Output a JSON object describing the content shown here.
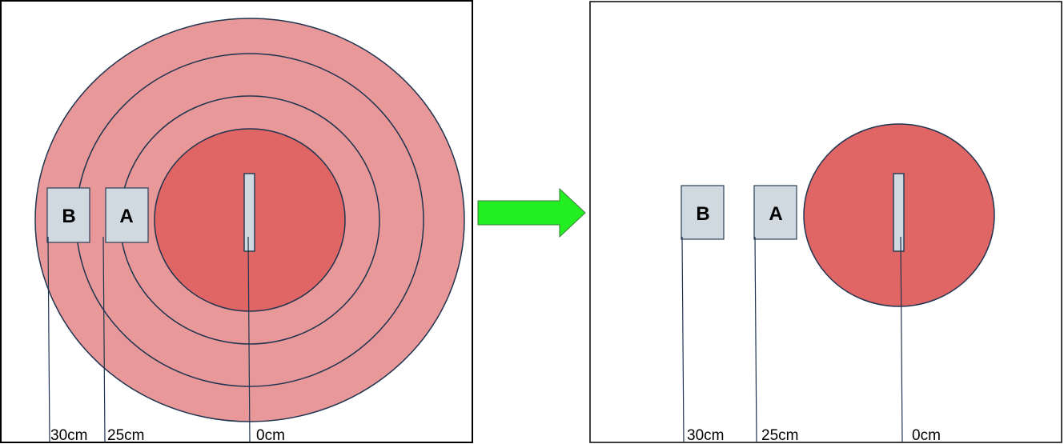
{
  "colors": {
    "outer_ring": "#e89898",
    "inner_zone": "#e06565",
    "ring_stroke": "#1f3450",
    "box_fill": "#d0d9e0",
    "box_stroke": "#2a3f55",
    "arrow_fill": "#22ee22",
    "arrow_stroke": "#3a7a3a",
    "text": "#000000"
  },
  "left_panel": {
    "boxes": [
      {
        "id": "B",
        "label": "B"
      },
      {
        "id": "A",
        "label": "A"
      }
    ],
    "distances": [
      "30cm",
      "25cm",
      "0cm"
    ]
  },
  "right_panel": {
    "boxes": [
      {
        "id": "B",
        "label": "B"
      },
      {
        "id": "A",
        "label": "A"
      }
    ],
    "distances": [
      "30cm",
      "25cm",
      "0cm"
    ]
  },
  "transition_arrow": {
    "icon": "right-arrow-icon",
    "color": "#22ee22"
  }
}
